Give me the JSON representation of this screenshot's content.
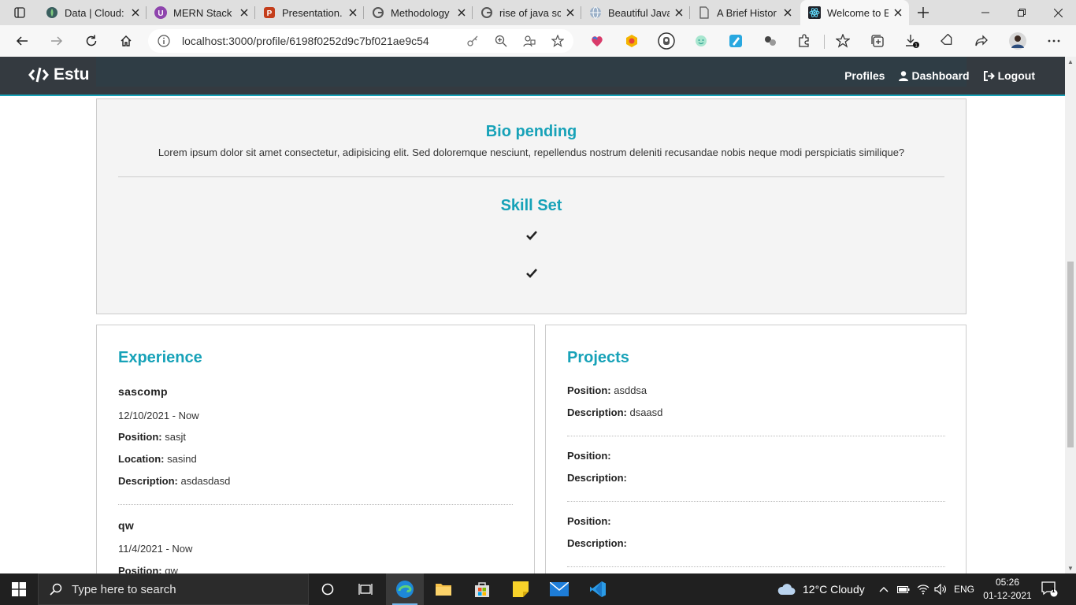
{
  "browser": {
    "tabs": [
      {
        "title": "Data | Cloud:",
        "icon": "mongodb-leaf-icon",
        "active": false
      },
      {
        "title": "MERN Stack F",
        "icon": "udemy-icon",
        "active": false
      },
      {
        "title": "Presentation.",
        "icon": "powerpoint-icon",
        "active": false
      },
      {
        "title": "Methodology",
        "icon": "google-icon",
        "active": false
      },
      {
        "title": "rise of java sc",
        "icon": "google-icon",
        "active": false
      },
      {
        "title": "Beautiful Java",
        "icon": "globe-icon",
        "active": false
      },
      {
        "title": "A Brief Histor",
        "icon": "document-icon",
        "active": false
      },
      {
        "title": "Welcome to E",
        "icon": "react-icon",
        "active": true
      }
    ],
    "url": "localhost:3000/profile/6198f0252d9c7bf021ae9c54"
  },
  "navbar": {
    "brand": "Estu",
    "links": [
      "Profiles",
      "Dashboard",
      "Logout"
    ]
  },
  "about": {
    "bio_title": "Bio pending",
    "bio_text": "Lorem ipsum dolor sit amet consectetur, adipisicing elit. Sed doloremque nesciunt, repellendus nostrum deleniti recusandae nobis neque modi perspiciatis similique?",
    "skills_title": "Skill Set",
    "skills": [
      "",
      ""
    ]
  },
  "experience": {
    "title": "Experience",
    "items": [
      {
        "company": "sascomp",
        "dates": "12/10/2021 - Now",
        "position_label": "Position:",
        "position": "sasjt",
        "location_label": "Location:",
        "location": "sasind",
        "description_label": "Description:",
        "description": "asdasdasd"
      },
      {
        "company": "qw",
        "dates": "11/4/2021 - Now",
        "position_label": "Position:",
        "position": "qw"
      }
    ]
  },
  "projects": {
    "title": "Projects",
    "items": [
      {
        "position_label": "Position:",
        "position": "asddsa",
        "description_label": "Description:",
        "description": "dsaasd"
      },
      {
        "position_label": "Position:",
        "position": "",
        "description_label": "Description:",
        "description": ""
      },
      {
        "position_label": "Position:",
        "position": "",
        "description_label": "Description:",
        "description": ""
      }
    ]
  },
  "taskbar": {
    "search_placeholder": "Type here to search",
    "weather": "12°C  Cloudy",
    "language": "ENG",
    "time": "05:26",
    "date": "01-12-2021",
    "notification_count": "1"
  },
  "colors": {
    "accent": "#17a2b8",
    "navbar": "#343a40"
  }
}
